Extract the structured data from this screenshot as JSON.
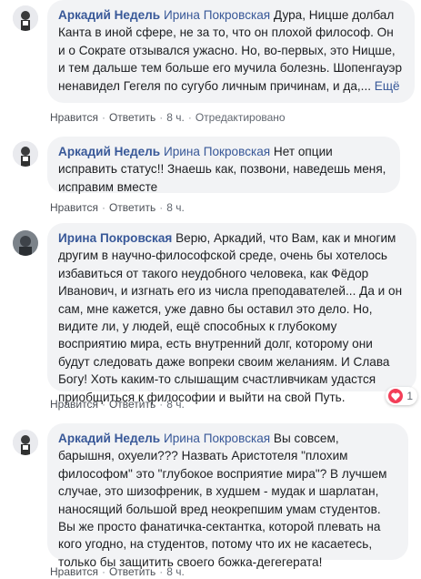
{
  "comments": [
    {
      "author": "Аркадий Недель",
      "mention": "Ирина Покровская",
      "text": " Дура, Ницше долбал Канта в иной сфере, не за то, что он плохой философ. Он и о Сократе отзывался ужасно. Но, во-первых, это Ницше, и тем дальше тем больше его мучила болезнь. Шопенгауэр ненавидел Гегеля по сугубо личным причинам, и да,...",
      "more": " Ещё",
      "like": "Нравится",
      "reply": "Ответить",
      "time": "8 ч.",
      "edited": "Отредактировано"
    },
    {
      "author": "Аркадий Недель",
      "mention": "Ирина Покровская",
      "text": " Нет опции исправить статус!! Знаешь как, позвони, наведешь меня, исправим вместе",
      "like": "Нравится",
      "reply": "Ответить",
      "time": "8 ч."
    },
    {
      "author": "Ирина Покровская",
      "text": " Верю, Аркадий, что Вам, как и многим другим в научно-философской среде, очень бы хотелось избавиться от такого неудобного человека, как Фёдор Иванович, и изгнать его из числа преподавателей... Да и он сам, мне кажется, уже давно бы оставил это дело. Но, видите ли, у людей, ещё способных к глубокому восприятию мира, есть внутренний долг, которому они будут следовать даже вопреки своим желаниям. И Слава Богу! Хоть каким-то слышащим счастливчикам удастся приобщиться к философии и выйти на свой Путь.",
      "like": "Нравится",
      "reply": "Ответить",
      "time": "8 ч.",
      "reaction_count": "1"
    },
    {
      "author": "Аркадий Недель",
      "mention": "Ирина Покровская",
      "text": " Вы совсем, барышня, охуели??? Назвать Аристотеля \"плохим философом\" это \"глубокое восприятие мира\"? В лучшем случае, это шизофреник, в худшем - мудак и шарлатан, наносящий большой вред неокрепшим умам студентов. Вы же просто фанатичка-сектантка, которой плевать на кого угодно, на студентов, потому что их не касаетесь, только бы защитить своего божка-дегегерата!",
      "like": "Нравится",
      "reply": "Ответить",
      "time": "8 ч."
    }
  ],
  "colors": {
    "link": "#385898",
    "bubble": "#f2f3f5",
    "heart": "#f33e58"
  }
}
